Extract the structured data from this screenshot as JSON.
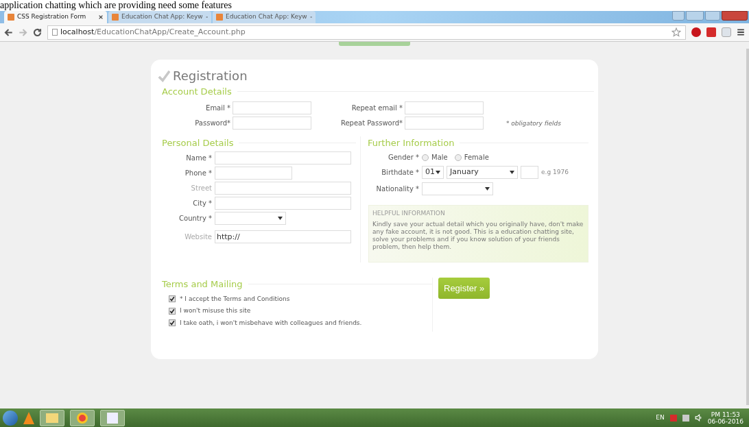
{
  "caption": "application chatting which are providing need some features",
  "tabs": [
    {
      "title": "CSS Registration Form",
      "selected": true
    },
    {
      "title": "Education Chat App: Keyw",
      "selected": false
    },
    {
      "title": "Education Chat App: Keyw",
      "selected": false
    }
  ],
  "url": {
    "host": "localhost",
    "path": "/EducationChatApp/Create_Account.php"
  },
  "form": {
    "title": "Registration",
    "account": {
      "legend": "Account Details",
      "note": "* obligatory fields",
      "fields": [
        {
          "label": "Email *",
          "muted": false
        },
        {
          "label": "Repeat email *",
          "muted": false
        },
        {
          "label": "Password*",
          "muted": false
        },
        {
          "label": "Repeat Password*",
          "muted": false
        }
      ]
    },
    "personal": {
      "legend": "Personal Details",
      "fields": [
        {
          "kind": "text",
          "label": "Name *",
          "muted": false,
          "wide": true
        },
        {
          "kind": "text",
          "label": "Phone *",
          "muted": false,
          "wide": false
        },
        {
          "kind": "text",
          "label": "Street",
          "muted": true,
          "wide": true
        },
        {
          "kind": "text",
          "label": "City *",
          "muted": false,
          "wide": true
        },
        {
          "kind": "select",
          "label": "Country *",
          "muted": false
        },
        {
          "kind": "text",
          "label": "Website",
          "muted": true,
          "wide": true,
          "value": "http://"
        }
      ]
    },
    "further": {
      "legend": "Further Information",
      "gender": {
        "label": "Gender *",
        "options": [
          {
            "label": "Male",
            "selected": false
          },
          {
            "label": "Female",
            "selected": false
          }
        ]
      },
      "birthdate": {
        "label": "Birthdate *",
        "day": "01",
        "month": "January",
        "hint": "e.g 1976"
      },
      "nationality": {
        "label": "Nationality *"
      },
      "info": {
        "heading": "HELPFUL INFORMATION",
        "text": "Kindly save your actual detail which you originally have, don't make any fake account, it is not good. This is a education chatting site, solve your problems and if you know solution of your friends problem, then help them."
      }
    },
    "terms": {
      "legend": "Terms and Mailing",
      "items": [
        {
          "label": "* I accept the Terms and Conditions",
          "checked": true
        },
        {
          "label": "I won't misuse this site",
          "checked": true
        },
        {
          "label": "I take oath, i won't misbehave with colleagues and friends.",
          "checked": true
        }
      ]
    },
    "submit": "Register »"
  },
  "taskbar": {
    "lang": "EN",
    "time": "PM 11:53",
    "date": "06-06-2016"
  }
}
